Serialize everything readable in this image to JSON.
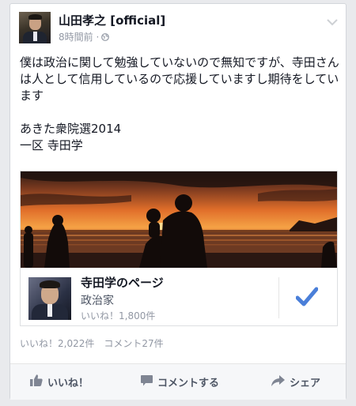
{
  "post": {
    "author": "山田孝之 [official]",
    "time": "8時間前 ·",
    "text": "僕は政治に関して勉強していないので無知ですが、寺田さんは人として信用しているので応援していますし期待をしています\n\nあきた衆院選2014\n一区 寺田学"
  },
  "shared_page": {
    "name": "寺田学のページ",
    "category": "政治家",
    "likes": "いいね！1,800件"
  },
  "stats": {
    "likes": "いいね！2,022件",
    "comments": "コメント27件"
  },
  "actions": {
    "like": "いいね！",
    "comment": "コメントする",
    "share": "シェア"
  },
  "colors": {
    "accent": "#4a7fd9",
    "secondary_text": "#9197a3"
  }
}
